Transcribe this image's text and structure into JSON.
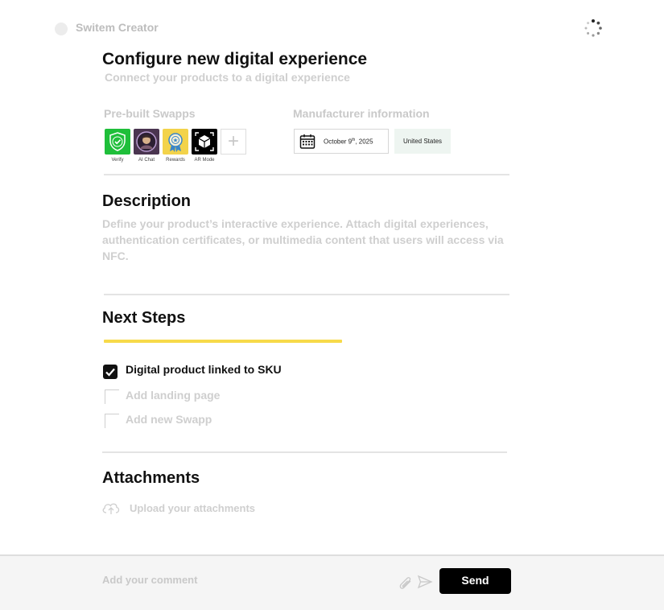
{
  "header": {
    "app_name": "Switem Creator",
    "spinner_icon": "loading-spinner-icon"
  },
  "title": "Configure new digital experience",
  "subtitle": "Connect your products to a digital experience",
  "prebuilt": {
    "label": "Pre-built Swapps",
    "items": [
      {
        "name": "Verify",
        "icon": "verify-shield-icon",
        "color": "#1fbf3a"
      },
      {
        "name": "AI Chat",
        "icon": "ai-chat-avatar-icon",
        "color": "#4a3550"
      },
      {
        "name": "Rewards",
        "icon": "rewards-medal-icon",
        "color": "#f3d34a"
      },
      {
        "name": "AR Mode",
        "icon": "ar-cube-icon",
        "color": "#000000"
      }
    ],
    "add_icon": "plus-icon"
  },
  "manufacturer": {
    "label": "Manufacturer information",
    "date_icon": "calendar-icon",
    "date_main": "October 9",
    "date_sup": "th",
    "date_year": ", 2025",
    "country": "United States"
  },
  "description": {
    "heading": "Description",
    "text": "Define your product’s interactive experience. Attach digital experiences, authentication certificates, or multimedia content that users will access via NFC."
  },
  "next_steps": {
    "heading": "Next Steps",
    "progress_fraction": 0.33,
    "items": [
      {
        "label": "Digital product linked to SKU",
        "checked": true
      },
      {
        "label": "Add landing page",
        "checked": false
      },
      {
        "label": "Add new Swapp",
        "checked": false
      }
    ]
  },
  "attachments": {
    "heading": "Attachments",
    "upload_icon": "cloud-upload-icon",
    "upload_label": "Upload your attachments"
  },
  "footer": {
    "comment_placeholder": "Add your comment",
    "attach_icon": "paperclip-icon",
    "send_icon": "paper-plane-icon",
    "send_label": "Send"
  },
  "colors": {
    "accent_yellow": "#f7da4a",
    "send_bg": "#000000",
    "country_bg": "#eef5f1"
  }
}
